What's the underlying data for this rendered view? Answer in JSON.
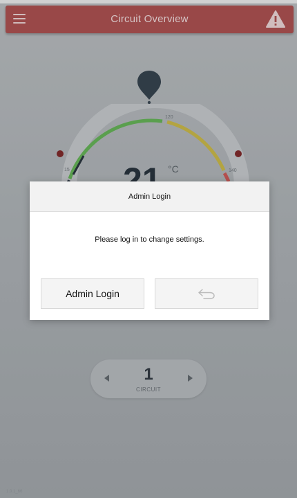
{
  "header": {
    "title": "Circuit Overview"
  },
  "gauge": {
    "temperature": "21",
    "unit": "°C",
    "ticks": {
      "t15": "15",
      "t120": "120",
      "t140": "140"
    }
  },
  "dialog": {
    "title": "Admin Login",
    "message": "Please log in to change settings.",
    "login_label": "Admin Login"
  },
  "circuit": {
    "number": "1",
    "label": "CIRCUIT"
  },
  "footer": {
    "version": "1.0.1_66"
  },
  "colors": {
    "header": "#a84847",
    "gauge_green": "#5fae4e",
    "gauge_yellow": "#c7b43f",
    "gauge_red": "#c9514e",
    "marker_dark": "#2a3540"
  },
  "icons": {
    "menu": "hamburger-icon",
    "warning": "warning-icon",
    "location": "location-pin-icon",
    "back": "back-arrow-icon"
  }
}
